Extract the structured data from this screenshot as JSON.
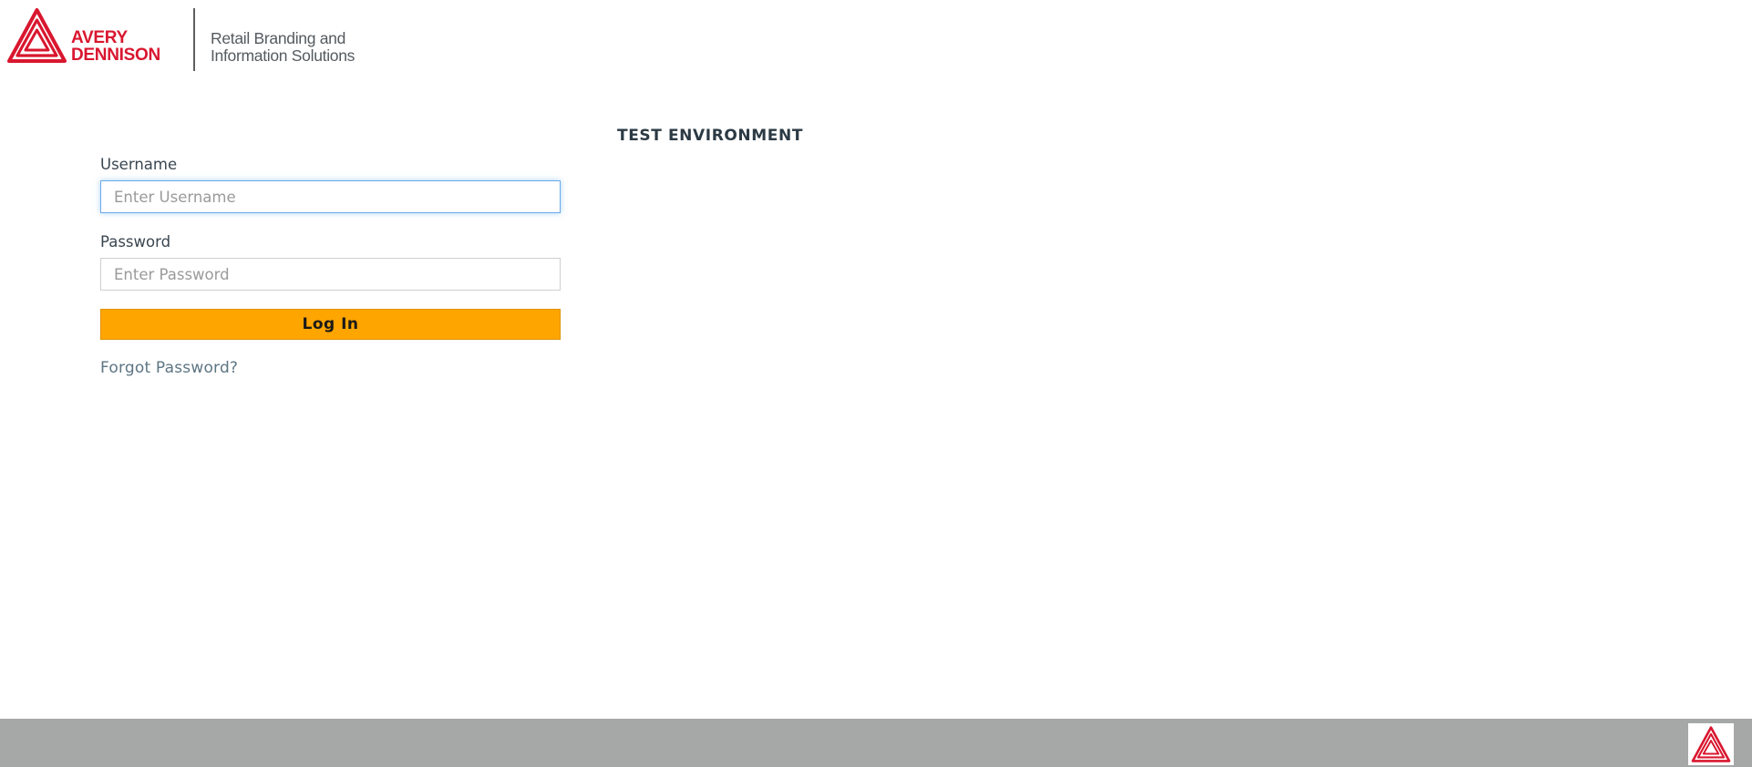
{
  "header": {
    "brand_line1": "AVERY",
    "brand_line2": "DENNISON",
    "tagline_line1": "Retail Branding and",
    "tagline_line2": "Information Solutions",
    "logo_icon": "avery-dennison-triangle-icon",
    "brand_color": "#d9172f"
  },
  "banner": {
    "environment": "TEST ENVIRONMENT"
  },
  "login": {
    "username_label": "Username",
    "username_placeholder": "Enter Username",
    "username_value": "",
    "password_label": "Password",
    "password_placeholder": "Enter Password",
    "password_value": "",
    "submit_label": "Log In",
    "forgot_label": "Forgot Password?",
    "button_color": "#ffa500"
  },
  "footer": {
    "logo_icon": "avery-dennison-triangle-icon",
    "background_color": "#a6a8a7"
  }
}
